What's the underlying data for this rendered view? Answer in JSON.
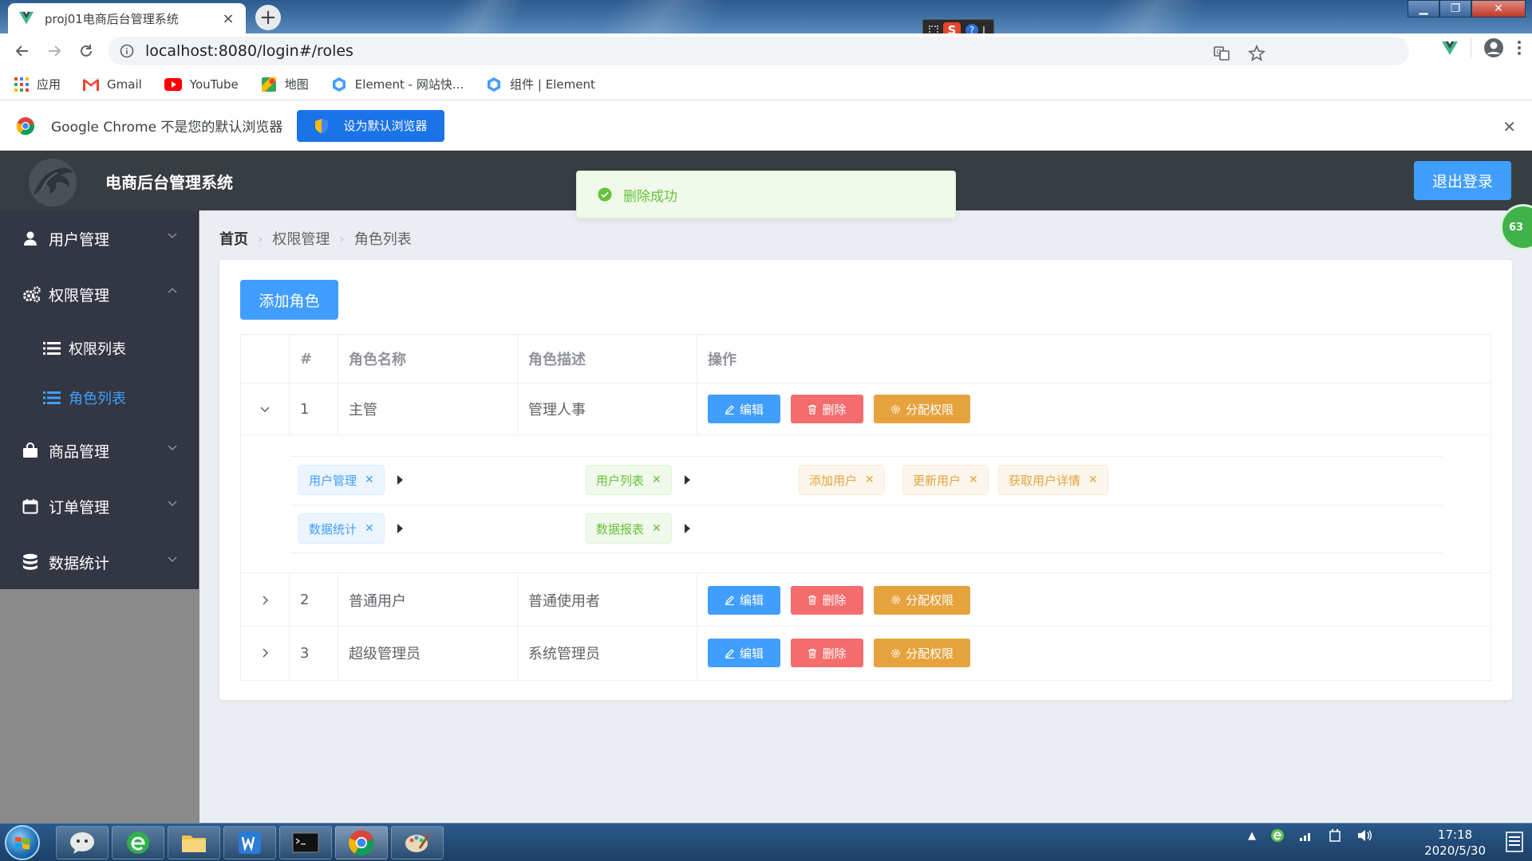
{
  "browser": {
    "tab_title": "proj01电商后台管理系统",
    "url": "localhost:8080/login#/roles",
    "bookmarks": [
      "应用",
      "Gmail",
      "YouTube",
      "地图",
      "Element - 网站快...",
      "组件 | Element"
    ],
    "infobar_message": "Google Chrome 不是您的默认浏览器",
    "infobar_button": "设为默认浏览器"
  },
  "header": {
    "title": "电商后台管理系统",
    "logout": "退出登录"
  },
  "toast": {
    "message": "删除成功",
    "color": "#67c23a"
  },
  "side_badge": "63",
  "sidebar": {
    "items": [
      {
        "label": "用户管理",
        "icon": "user-icon"
      },
      {
        "label": "权限管理",
        "icon": "gears-icon",
        "expanded": true,
        "children": [
          {
            "label": "权限列表",
            "icon": "list-icon"
          },
          {
            "label": "角色列表",
            "icon": "list-icon",
            "active": true
          }
        ]
      },
      {
        "label": "商品管理",
        "icon": "shopping-bag-icon"
      },
      {
        "label": "订单管理",
        "icon": "calendar-icon"
      },
      {
        "label": "数据统计",
        "icon": "database-icon"
      }
    ],
    "active_color": "#409eff"
  },
  "breadcrumb": [
    "首页",
    "权限管理",
    "角色列表"
  ],
  "page": {
    "add_button": "添加角色"
  },
  "table": {
    "headers": [
      "#",
      "角色名称",
      "角色描述",
      "操作"
    ],
    "actions": {
      "edit": "编辑",
      "delete": "删除",
      "assign": "分配权限"
    },
    "rows": [
      {
        "index": "1",
        "name": "主管",
        "desc": "管理人事",
        "expanded": true
      },
      {
        "index": "2",
        "name": "普通用户",
        "desc": "普通使用者"
      },
      {
        "index": "3",
        "name": "超级管理员",
        "desc": "系统管理员"
      }
    ],
    "expanded_rights": [
      {
        "level1": "用户管理",
        "level2": [
          {
            "name": "用户列表",
            "level3": [
              "添加用户",
              "更新用户",
              "获取用户详情"
            ]
          }
        ]
      },
      {
        "level1": "数据统计",
        "level2": [
          {
            "name": "数据报表",
            "level3": []
          }
        ]
      }
    ]
  },
  "taskbar": {
    "time": "17:18",
    "date": "2020/5/30"
  },
  "colors": {
    "primary": "#409eff",
    "danger": "#f56c6c",
    "warning": "#e6a23c",
    "success": "#67c23a",
    "header_bg": "#373d41",
    "sidebar_bg": "#333744",
    "main_bg": "#eaedf1"
  }
}
